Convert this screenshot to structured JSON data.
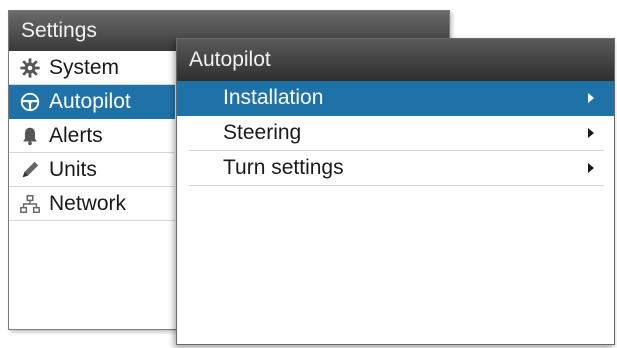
{
  "settings": {
    "title": "Settings",
    "items": [
      {
        "label": "System",
        "icon": "gear-icon",
        "selected": false
      },
      {
        "label": "Autopilot",
        "icon": "steering-wheel-icon",
        "selected": true
      },
      {
        "label": "Alerts",
        "icon": "bell-icon",
        "selected": false
      },
      {
        "label": "Units",
        "icon": "pencil-icon",
        "selected": false
      },
      {
        "label": "Network",
        "icon": "network-icon",
        "selected": false
      }
    ]
  },
  "autopilot": {
    "title": "Autopilot",
    "items": [
      {
        "label": "Installation",
        "selected": true
      },
      {
        "label": "Steering",
        "selected": false
      },
      {
        "label": "Turn settings",
        "selected": false
      }
    ]
  },
  "colors": {
    "selection": "#1f72a8",
    "titlebar": "#3a3a3a"
  }
}
